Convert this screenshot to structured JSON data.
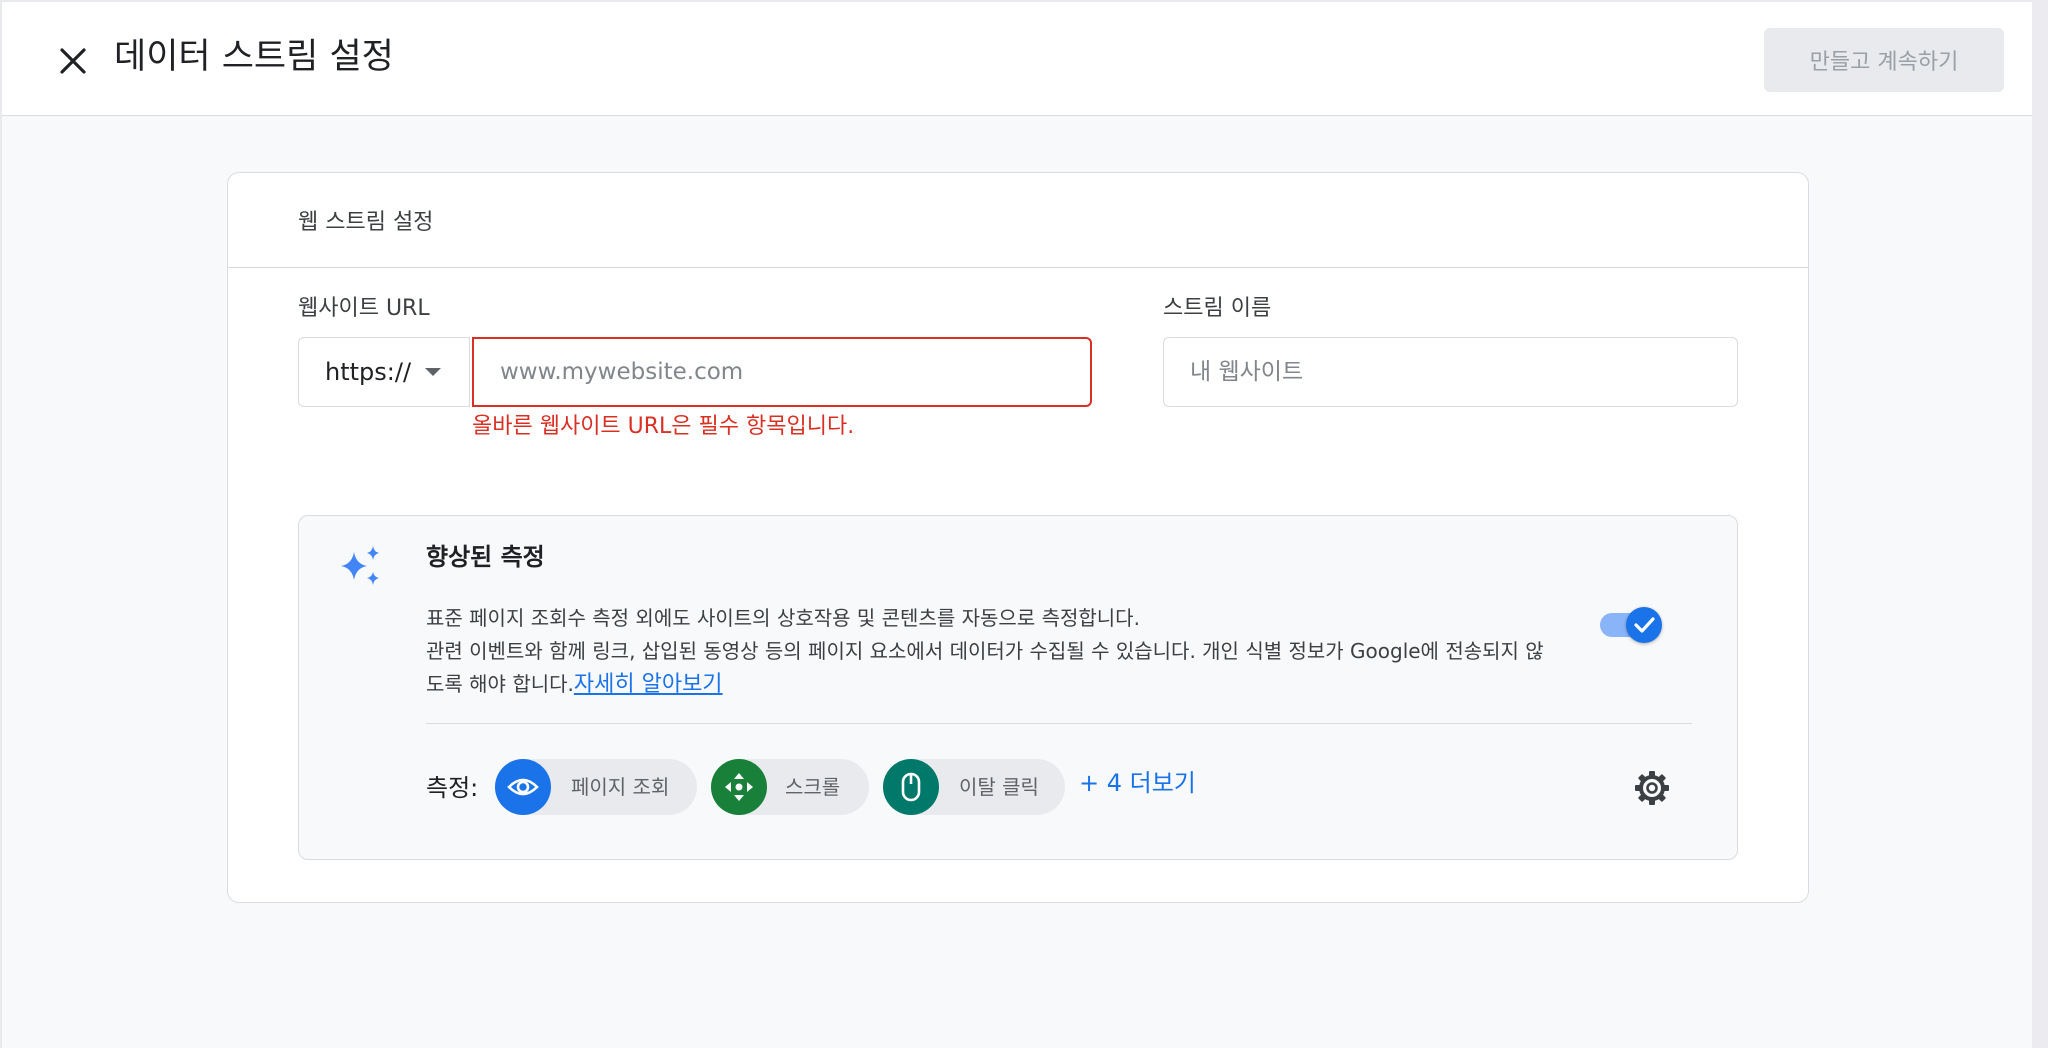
{
  "header": {
    "title": "데이터 스트림 설정",
    "create_button": "만들고 계속하기"
  },
  "card": {
    "title": "웹 스트림 설정",
    "url_label": "웹사이트 URL",
    "protocol_value": "https://",
    "url_placeholder": "www.mywebsite.com",
    "url_error": "올바른 웹사이트 URL은 필수 항목입니다.",
    "name_label": "스트림 이름",
    "name_placeholder": "내 웹사이트"
  },
  "enhanced": {
    "title": "향상된 측정",
    "line1": "표준 페이지 조회수 측정 외에도 사이트의 상호작용 및 콘텐츠를 자동으로 측정합니다.",
    "line2": "관련 이벤트와 함께 링크, 삽입된 동영상 등의 페이지 요소에서 데이터가 수집될 수 있습니다. 개인 식별 정보가 Google에 전송되지 않도록 해야 합니다.",
    "learn_more": "자세히 알아보기",
    "toggle_on": true,
    "measure_label": "측정:",
    "chips": [
      {
        "label": "페이지 조회",
        "icon": "eye-icon",
        "color": "#1a73e8"
      },
      {
        "label": "스크롤",
        "icon": "scroll-icon",
        "color": "#188038"
      },
      {
        "label": "이탈 클릭",
        "icon": "mouse-icon",
        "color": "#00796b"
      }
    ],
    "more_link": "+ 4 더보기"
  },
  "colors": {
    "accent": "#1a73e8",
    "error": "#d93025"
  }
}
